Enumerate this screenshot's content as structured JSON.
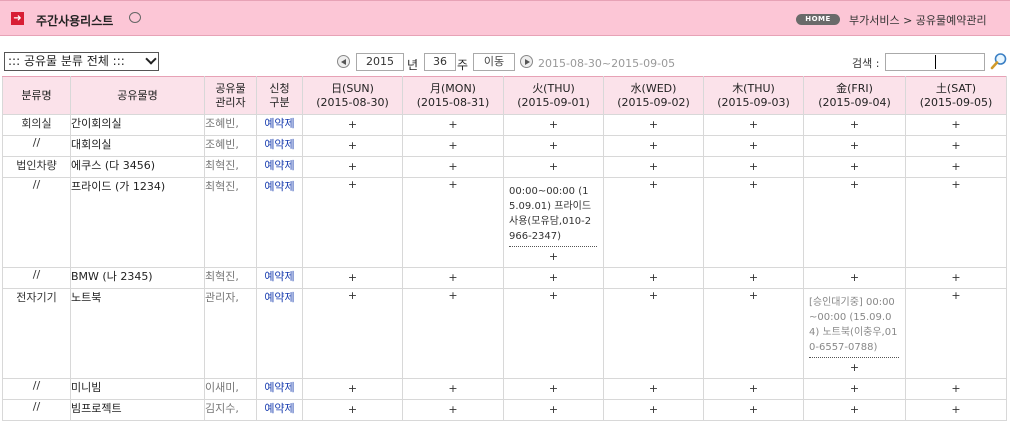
{
  "header": {
    "title": "주간사용리스트",
    "home_badge": "HOME",
    "breadcrumb": "부가서비스 > 공유물예약관리"
  },
  "toolbar": {
    "category_select": ":::  공유물 분류 전체 :::",
    "year": "2015",
    "year_unit": "년",
    "week": "36",
    "week_unit": "주",
    "move_button": "이동",
    "date_range": "2015-08-30~2015-09-05",
    "search_label": "검색 :",
    "search_value": ""
  },
  "table": {
    "headers": {
      "category": "분류명",
      "resource": "공유물명",
      "manager_line1": "공유물",
      "manager_line2": "관리자",
      "request_line1": "신청",
      "request_line2": "구분"
    },
    "days": [
      {
        "label": "日(SUN)",
        "date": "(2015-08-30)"
      },
      {
        "label": "月(MON)",
        "date": "(2015-08-31)"
      },
      {
        "label": "火(THU)",
        "date": "(2015-09-01)"
      },
      {
        "label": "水(WED)",
        "date": "(2015-09-02)"
      },
      {
        "label": "木(THU)",
        "date": "(2015-09-03)"
      },
      {
        "label": "金(FRI)",
        "date": "(2015-09-04)"
      },
      {
        "label": "土(SAT)",
        "date": "(2015-09-05)"
      }
    ],
    "add_symbol": "+",
    "rows": [
      {
        "category": "회의실",
        "resource": "간이회의실",
        "manager": "조혜빈,",
        "request": "예약제"
      },
      {
        "category": "//",
        "resource": "대회의실",
        "manager": "조혜빈,",
        "request": "예약제"
      },
      {
        "category": "법인차량",
        "resource": "에쿠스 (다 3456)",
        "manager": "최혁진,",
        "request": "예약제"
      },
      {
        "category": "//",
        "resource": "프라이드 (가 1234)",
        "manager": "최혁진,",
        "request": "예약제",
        "booking_day": 2,
        "booking": "00:00~00:00 (15.09.01) 프라이드 사용(모유담,010-2966-2347)"
      },
      {
        "category": "//",
        "resource": "BMW (나 2345)",
        "manager": "최혁진,",
        "request": "예약제"
      },
      {
        "category": "전자기기",
        "resource": "노트북",
        "manager": "관리자,",
        "request": "예약제",
        "booking_day": 5,
        "booking": "[승인대기중] 00:00~00:00 (15.09.04) 노트북(이충우,010-6557-0788)"
      },
      {
        "category": "//",
        "resource": "미니빔",
        "manager": "이새미,",
        "request": "예약제"
      },
      {
        "category": "//",
        "resource": "빔프로젝트",
        "manager": "김지수,",
        "request": "예약제"
      }
    ]
  },
  "colors": {
    "header_bg": "#fcc6d6",
    "table_head_bg": "#fbe2ea",
    "sunday": "#d81d34",
    "saturday": "#2233bb",
    "link": "#1b3fb0"
  }
}
